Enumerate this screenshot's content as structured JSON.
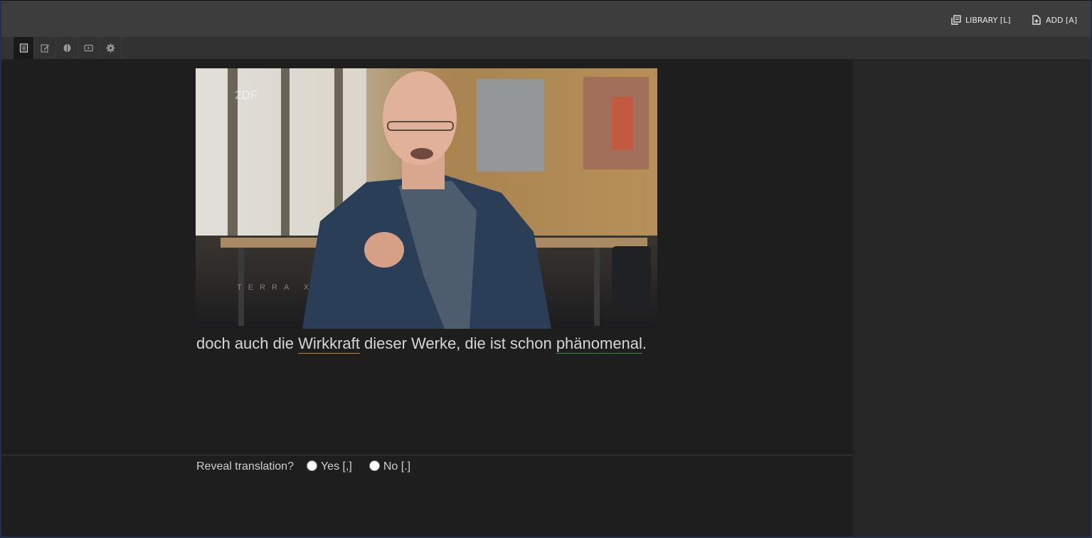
{
  "header": {
    "library_label": "LIBRARY [L]",
    "add_label": "ADD [A]",
    "library_icon": "library-icon",
    "add_icon": "add-file-icon"
  },
  "toolbar": {
    "tools": [
      {
        "name": "reader-icon",
        "active": true
      },
      {
        "name": "edit-icon",
        "active": false
      },
      {
        "name": "brain-icon",
        "active": false
      },
      {
        "name": "media-icon",
        "active": false
      },
      {
        "name": "gear-icon",
        "active": false
      }
    ]
  },
  "video": {
    "channel_logo": "2DF",
    "watermark": "TERRA X"
  },
  "sentence": {
    "part1": "doch auch die ",
    "word1": "Wirkkraft",
    "part2": " dieser Werke, die ist schon ",
    "word2": "phänomenal",
    "part3": "."
  },
  "reveal": {
    "question": "Reveal translation?",
    "yes_label": "Yes [,]",
    "no_label": "No [.]"
  },
  "colors": {
    "underline_orange": "#c7861d",
    "underline_green": "#3d8f3d"
  }
}
